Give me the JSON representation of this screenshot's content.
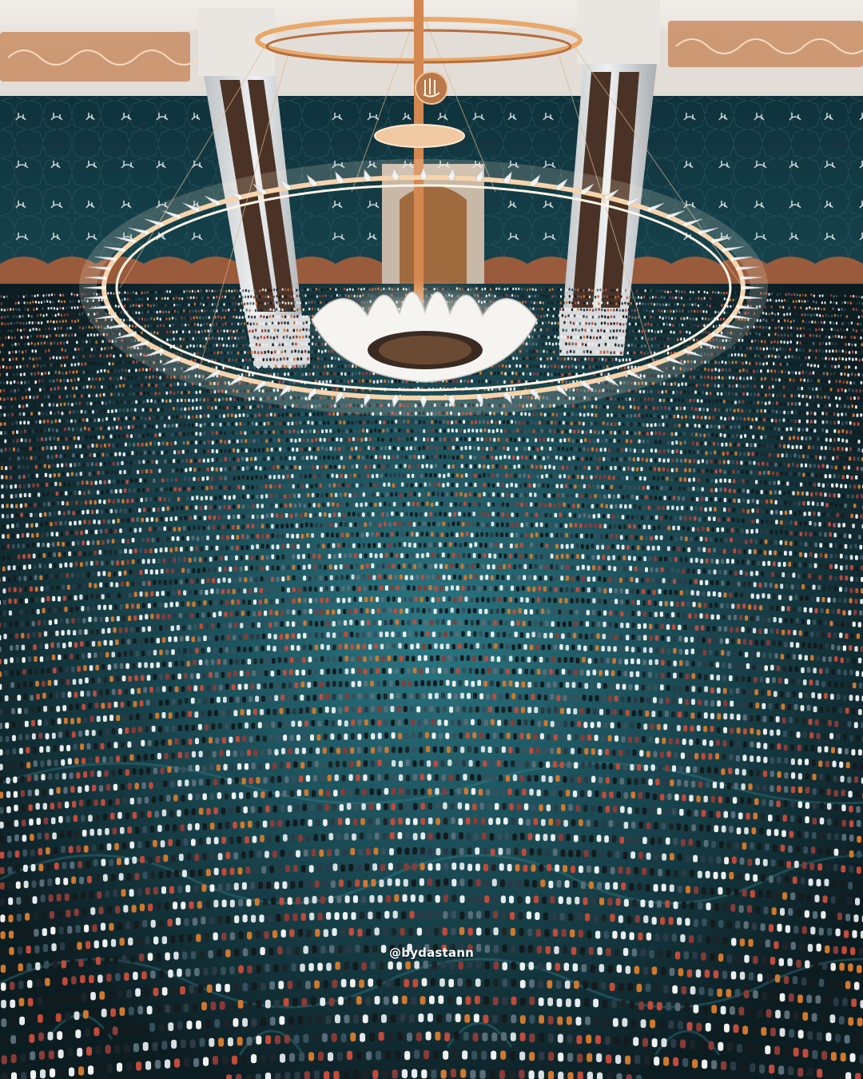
{
  "photo": {
    "watermark": "@bydastann"
  },
  "colors": {
    "ceiling": "#e9e4df",
    "wall_tile": "#123a44",
    "gold": "#e8a86a",
    "carpet_teal": "#1f5c66",
    "carpet_dark": "#0c1e23",
    "crowd_dark": "#151a1d",
    "crowd_light": "#e8ecee"
  },
  "icons": {
    "chandelier": "chandelier-icon",
    "calligraphy": "calligraphy-icon"
  }
}
